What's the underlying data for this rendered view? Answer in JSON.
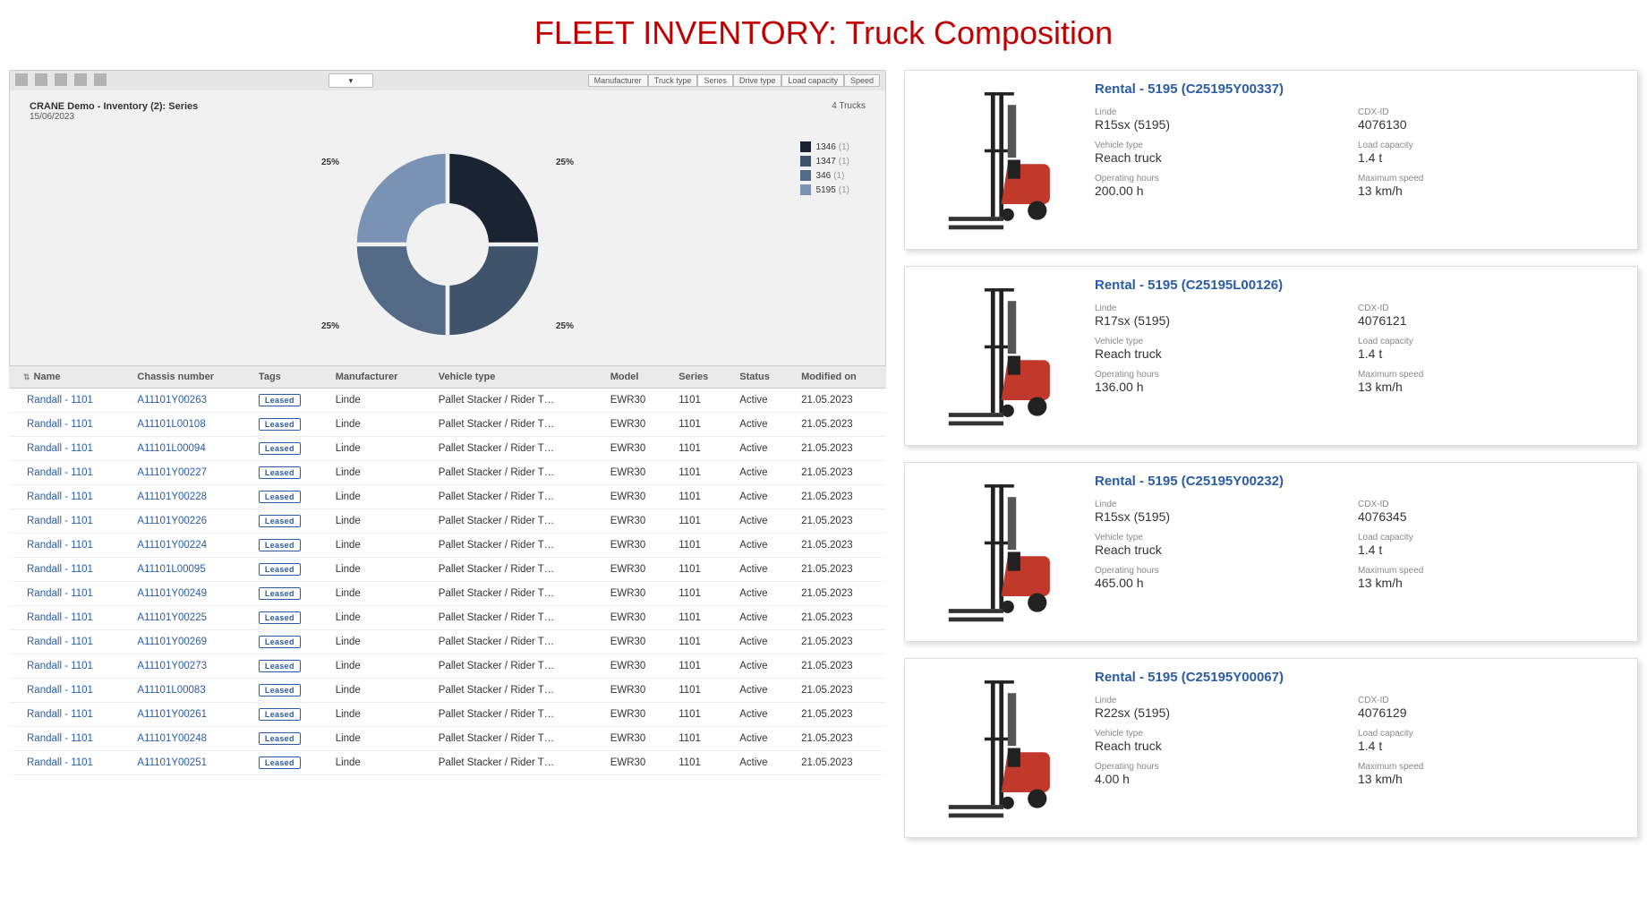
{
  "page_title": "FLEET INVENTORY: Truck Composition",
  "toolbar": {
    "icons": [
      "back-icon",
      "home-icon",
      "refresh-icon",
      "doc-icon",
      "save-icon"
    ],
    "tabs": [
      "Manufacturer",
      "Truck type",
      "Series",
      "Drive type",
      "Load capacity",
      "Speed"
    ],
    "active_tab": "Series"
  },
  "chart": {
    "title": "CRANE Demo - Inventory (2):  Series",
    "date": "15/06/2023",
    "count_label": "4 Trucks",
    "legend": [
      {
        "label": "1346",
        "count": "(1)",
        "color": "#1a2332"
      },
      {
        "label": "1347",
        "count": "(1)",
        "color": "#3f536b"
      },
      {
        "label": "346",
        "count": "(1)",
        "color": "#536a86"
      },
      {
        "label": "5195",
        "count": "(1)",
        "color": "#7a93b4"
      }
    ],
    "slices": [
      {
        "pct": "25%",
        "pos": "top-left"
      },
      {
        "pct": "25%",
        "pos": "top-right"
      },
      {
        "pct": "25%",
        "pos": "bottom-right"
      },
      {
        "pct": "25%",
        "pos": "bottom-left"
      }
    ]
  },
  "chart_data": {
    "type": "pie",
    "title": "CRANE Demo - Inventory (2):  Series",
    "categories": [
      "1346",
      "1347",
      "346",
      "5195"
    ],
    "values": [
      1,
      1,
      1,
      1
    ],
    "colors": [
      "#1a2332",
      "#3f536b",
      "#536a86",
      "#7a93b4"
    ],
    "annotation": "4 Trucks",
    "date": "15/06/2023"
  },
  "table": {
    "headers": [
      "Name",
      "Chassis number",
      "Tags",
      "Manufacturer",
      "Vehicle type",
      "Model",
      "Series",
      "Status",
      "Modified on"
    ],
    "tag_label": "Leased",
    "rows": [
      {
        "name": "Randall - 1101",
        "chassis": "A11101Y00263",
        "manufacturer": "Linde",
        "vehicle_type": "Pallet Stacker / Rider T…",
        "model": "EWR30",
        "series": "1101",
        "status": "Active",
        "modified": "21.05.2023"
      },
      {
        "name": "Randall - 1101",
        "chassis": "A11101L00108",
        "manufacturer": "Linde",
        "vehicle_type": "Pallet Stacker / Rider T…",
        "model": "EWR30",
        "series": "1101",
        "status": "Active",
        "modified": "21.05.2023"
      },
      {
        "name": "Randall - 1101",
        "chassis": "A11101L00094",
        "manufacturer": "Linde",
        "vehicle_type": "Pallet Stacker / Rider T…",
        "model": "EWR30",
        "series": "1101",
        "status": "Active",
        "modified": "21.05.2023"
      },
      {
        "name": "Randall - 1101",
        "chassis": "A11101Y00227",
        "manufacturer": "Linde",
        "vehicle_type": "Pallet Stacker / Rider T…",
        "model": "EWR30",
        "series": "1101",
        "status": "Active",
        "modified": "21.05.2023"
      },
      {
        "name": "Randall - 1101",
        "chassis": "A11101Y00228",
        "manufacturer": "Linde",
        "vehicle_type": "Pallet Stacker / Rider T…",
        "model": "EWR30",
        "series": "1101",
        "status": "Active",
        "modified": "21.05.2023"
      },
      {
        "name": "Randall - 1101",
        "chassis": "A11101Y00226",
        "manufacturer": "Linde",
        "vehicle_type": "Pallet Stacker / Rider T…",
        "model": "EWR30",
        "series": "1101",
        "status": "Active",
        "modified": "21.05.2023"
      },
      {
        "name": "Randall - 1101",
        "chassis": "A11101Y00224",
        "manufacturer": "Linde",
        "vehicle_type": "Pallet Stacker / Rider T…",
        "model": "EWR30",
        "series": "1101",
        "status": "Active",
        "modified": "21.05.2023"
      },
      {
        "name": "Randall - 1101",
        "chassis": "A11101L00095",
        "manufacturer": "Linde",
        "vehicle_type": "Pallet Stacker / Rider T…",
        "model": "EWR30",
        "series": "1101",
        "status": "Active",
        "modified": "21.05.2023"
      },
      {
        "name": "Randall - 1101",
        "chassis": "A11101Y00249",
        "manufacturer": "Linde",
        "vehicle_type": "Pallet Stacker / Rider T…",
        "model": "EWR30",
        "series": "1101",
        "status": "Active",
        "modified": "21.05.2023"
      },
      {
        "name": "Randall - 1101",
        "chassis": "A11101Y00225",
        "manufacturer": "Linde",
        "vehicle_type": "Pallet Stacker / Rider T…",
        "model": "EWR30",
        "series": "1101",
        "status": "Active",
        "modified": "21.05.2023"
      },
      {
        "name": "Randall - 1101",
        "chassis": "A11101Y00269",
        "manufacturer": "Linde",
        "vehicle_type": "Pallet Stacker / Rider T…",
        "model": "EWR30",
        "series": "1101",
        "status": "Active",
        "modified": "21.05.2023"
      },
      {
        "name": "Randall - 1101",
        "chassis": "A11101Y00273",
        "manufacturer": "Linde",
        "vehicle_type": "Pallet Stacker / Rider T…",
        "model": "EWR30",
        "series": "1101",
        "status": "Active",
        "modified": "21.05.2023"
      },
      {
        "name": "Randall - 1101",
        "chassis": "A11101L00083",
        "manufacturer": "Linde",
        "vehicle_type": "Pallet Stacker / Rider T…",
        "model": "EWR30",
        "series": "1101",
        "status": "Active",
        "modified": "21.05.2023"
      },
      {
        "name": "Randall - 1101",
        "chassis": "A11101Y00261",
        "manufacturer": "Linde",
        "vehicle_type": "Pallet Stacker / Rider T…",
        "model": "EWR30",
        "series": "1101",
        "status": "Active",
        "modified": "21.05.2023"
      },
      {
        "name": "Randall - 1101",
        "chassis": "A11101Y00248",
        "manufacturer": "Linde",
        "vehicle_type": "Pallet Stacker / Rider T…",
        "model": "EWR30",
        "series": "1101",
        "status": "Active",
        "modified": "21.05.2023"
      },
      {
        "name": "Randall - 1101",
        "chassis": "A11101Y00251",
        "manufacturer": "Linde",
        "vehicle_type": "Pallet Stacker / Rider T…",
        "model": "EWR30",
        "series": "1101",
        "status": "Active",
        "modified": "21.05.2023"
      }
    ]
  },
  "cards": [
    {
      "title": "Rental - 5195 (C25195Y00337)",
      "specs": {
        "linde": "R15sx (5195)",
        "cdx": [
          "CDX-ID",
          "4076130"
        ],
        "vehicle_type": [
          "Vehicle type",
          "Reach truck"
        ],
        "load": [
          "Load capacity",
          "1.4 t"
        ],
        "hours": [
          "Operating hours",
          "200.00 h"
        ],
        "speed": [
          "Maximum speed",
          "13 km/h"
        ]
      }
    },
    {
      "title": "Rental - 5195 (C25195L00126)",
      "specs": {
        "linde": "R17sx (5195)",
        "cdx": [
          "CDX-ID",
          "4076121"
        ],
        "vehicle_type": [
          "Vehicle type",
          "Reach truck"
        ],
        "load": [
          "Load capacity",
          "1.4 t"
        ],
        "hours": [
          "Operating hours",
          "136.00 h"
        ],
        "speed": [
          "Maximum speed",
          "13 km/h"
        ]
      }
    },
    {
      "title": "Rental - 5195 (C25195Y00232)",
      "specs": {
        "linde": "R15sx (5195)",
        "cdx": [
          "CDX-ID",
          "4076345"
        ],
        "vehicle_type": [
          "Vehicle type",
          "Reach truck"
        ],
        "load": [
          "Load capacity",
          "1.4 t"
        ],
        "hours": [
          "Operating hours",
          "465.00 h"
        ],
        "speed": [
          "Maximum speed",
          "13 km/h"
        ]
      }
    },
    {
      "title": "Rental - 5195 (C25195Y00067)",
      "specs": {
        "linde": "R22sx (5195)",
        "cdx": [
          "CDX-ID",
          "4076129"
        ],
        "vehicle_type": [
          "Vehicle type",
          "Reach truck"
        ],
        "load": [
          "Load capacity",
          "1.4 t"
        ],
        "hours": [
          "Operating hours",
          "4.00 h"
        ],
        "speed": [
          "Maximum speed",
          "13 km/h"
        ]
      }
    }
  ],
  "spec_labels": {
    "linde": "Linde"
  }
}
